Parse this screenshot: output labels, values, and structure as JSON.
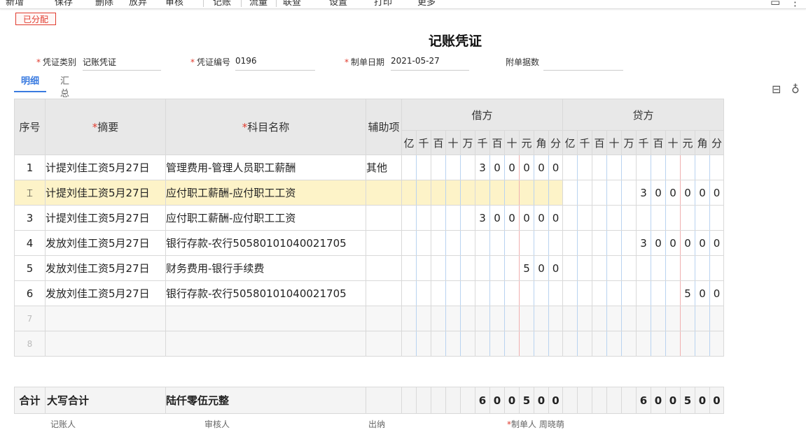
{
  "toolbar": {
    "items": [
      "新增",
      "保存",
      "删除",
      "放弃",
      "审核",
      "记账",
      "流量",
      "联查",
      "设置",
      "打印",
      "更多"
    ]
  },
  "voucher": {
    "status": "已分配",
    "title": "记账凭证",
    "type_label": "凭证类别",
    "type_value": "记账凭证",
    "number_label": "凭证编号",
    "number_value": "0196",
    "date_label": "制单日期",
    "date_value": "2021-05-27",
    "attach_label": "附单据数",
    "attach_value": ""
  },
  "tabs": [
    "明细",
    "汇总"
  ],
  "table": {
    "headers": {
      "seq": "序号",
      "summary": "摘要",
      "account": "科目名称",
      "aux": "辅助项",
      "debit": "借方",
      "credit": "贷方"
    },
    "digit_headers": [
      "亿",
      "千",
      "百",
      "十",
      "万",
      "千",
      "百",
      "十",
      "元",
      "角",
      "分"
    ],
    "rows": [
      {
        "seq": "1",
        "summary": "计提刘佳工资5月27日",
        "account": "管理费用-管理人员职工薪酬",
        "aux": "其他",
        "debit": [
          "",
          "",
          "",
          "",
          "",
          "3",
          "0",
          "0",
          "0",
          "0",
          "0"
        ],
        "credit": [
          "",
          "",
          "",
          "",
          "",
          "",
          "",
          "",
          "",
          "",
          ""
        ]
      },
      {
        "seq": "⌶",
        "summary": "计提刘佳工资5月27日",
        "account": "应付职工薪酬-应付职工工资",
        "aux": "",
        "debit": [
          "",
          "",
          "",
          "",
          "",
          "",
          "",
          "",
          "",
          "",
          ""
        ],
        "credit": [
          "",
          "",
          "",
          "",
          "",
          "3",
          "0",
          "0",
          "0",
          "0",
          "0"
        ]
      },
      {
        "seq": "3",
        "summary": "计提刘佳工资5月27日",
        "account": "应付职工薪酬-应付职工工资",
        "aux": "",
        "debit": [
          "",
          "",
          "",
          "",
          "",
          "3",
          "0",
          "0",
          "0",
          "0",
          "0"
        ],
        "credit": [
          "",
          "",
          "",
          "",
          "",
          "",
          "",
          "",
          "",
          "",
          ""
        ]
      },
      {
        "seq": "4",
        "summary": "发放刘佳工资5月27日",
        "account": "银行存款-农行50580101040021705",
        "aux": "",
        "debit": [
          "",
          "",
          "",
          "",
          "",
          "",
          "",
          "",
          "",
          "",
          ""
        ],
        "credit": [
          "",
          "",
          "",
          "",
          "",
          "3",
          "0",
          "0",
          "0",
          "0",
          "0"
        ]
      },
      {
        "seq": "5",
        "summary": "发放刘佳工资5月27日",
        "account": "财务费用-银行手续费",
        "aux": "",
        "debit": [
          "",
          "",
          "",
          "",
          "",
          "",
          "",
          "",
          "5",
          "0",
          "0"
        ],
        "credit": [
          "",
          "",
          "",
          "",
          "",
          "",
          "",
          "",
          "",
          "",
          ""
        ]
      },
      {
        "seq": "6",
        "summary": "发放刘佳工资5月27日",
        "account": "银行存款-农行50580101040021705",
        "aux": "",
        "debit": [
          "",
          "",
          "",
          "",
          "",
          "",
          "",
          "",
          "",
          "",
          ""
        ],
        "credit": [
          "",
          "",
          "",
          "",
          "",
          "",
          "",
          "",
          "5",
          "0",
          "0"
        ]
      },
      {
        "seq": "7",
        "summary": "",
        "account": "",
        "aux": "",
        "debit": [
          "",
          "",
          "",
          "",
          "",
          "",
          "",
          "",
          "",
          "",
          ""
        ],
        "credit": [
          "",
          "",
          "",
          "",
          "",
          "",
          "",
          "",
          "",
          "",
          ""
        ]
      },
      {
        "seq": "8",
        "summary": "",
        "account": "",
        "aux": "",
        "debit": [
          "",
          "",
          "",
          "",
          "",
          "",
          "",
          "",
          "",
          "",
          ""
        ],
        "credit": [
          "",
          "",
          "",
          "",
          "",
          "",
          "",
          "",
          "",
          "",
          ""
        ]
      }
    ]
  },
  "totals": {
    "label": "合计",
    "upper_label": "大写合计",
    "upper_value": "陆仟零伍元整",
    "debit": [
      "",
      "",
      "",
      "",
      "",
      "6",
      "0",
      "0",
      "5",
      "0",
      "0"
    ],
    "credit": [
      "",
      "",
      "",
      "",
      "",
      "6",
      "0",
      "0",
      "5",
      "0",
      "0"
    ]
  },
  "footer": {
    "bookkeeper": "记账人",
    "reviewer": "审核人",
    "cashier": "出纳",
    "maker": "制单人 周晓萌"
  }
}
